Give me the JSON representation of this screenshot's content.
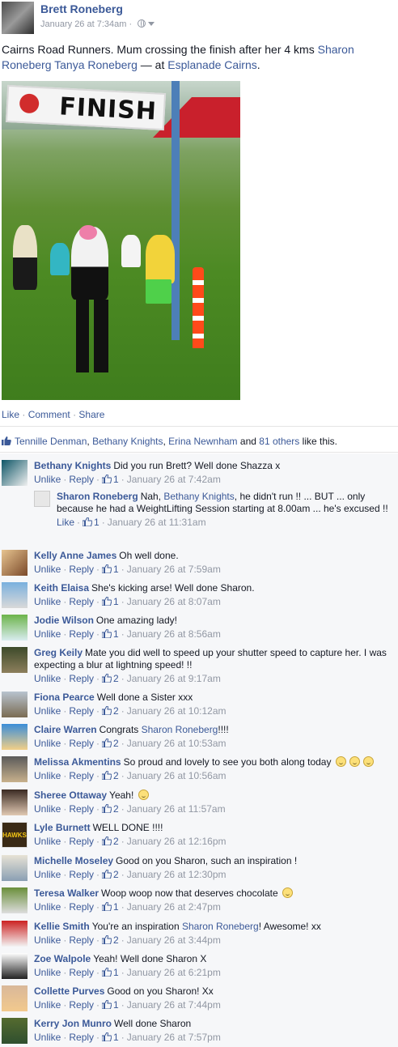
{
  "post": {
    "author": "Brett Roneberg",
    "time": "January 26 at 7:34am",
    "separator": "·",
    "privacy_icon": "globe-icon",
    "text_prefix": "Cairns Road Runners. Mum crossing the finish after her 4 kms ",
    "tag1": "Sharon Roneberg",
    "tag2": "Tanya Roneberg",
    "at_text": " — at ",
    "place": "Esplanade Cairns",
    "period": ".",
    "photo_banner": "FINISH"
  },
  "actions": {
    "like": "Like",
    "comment": "Comment",
    "share": "Share",
    "dot": "·"
  },
  "likes": {
    "icon": "thumbs-up-icon",
    "name1": "Tennille Denman",
    "name2": "Bethany Knights",
    "name3": "Erina Newnham",
    "and": "and",
    "others": "81 others",
    "suffix": "like this.",
    "comma": ","
  },
  "comments": [
    {
      "name": "Bethany Knights",
      "text": "Did you run Brett? Well done Shazza x",
      "action": "Unlike",
      "reply": "Reply",
      "likes": "1",
      "time": "January 26 at 7:42am"
    },
    {
      "name": "Sharon Roneberg",
      "text_a": "Nah, ",
      "mention": "Bethany Knights",
      "text_b": ", he didn't run !! ... BUT ... only because he had a WeightLifting Session starting at 8.00am ... he's excused !!",
      "action": "Like",
      "likes": "1",
      "time": "January 26 at 11:31am"
    },
    {
      "name": "Kelly Anne James",
      "text": "Oh well done.",
      "action": "Unlike",
      "reply": "Reply",
      "likes": "1",
      "time": "January 26 at 7:59am"
    },
    {
      "name": "Keith Elaisa",
      "text": "She's kicking arse! Well done Sharon.",
      "action": "Unlike",
      "reply": "Reply",
      "likes": "1",
      "time": "January 26 at 8:07am"
    },
    {
      "name": "Jodie Wilson",
      "text": "One amazing lady!",
      "action": "Unlike",
      "reply": "Reply",
      "likes": "1",
      "time": "January 26 at 8:56am"
    },
    {
      "name": "Greg Keily",
      "text": "Mate you did well to speed up your shutter speed to capture her. I was expecting a blur at lightning speed! !!",
      "action": "Unlike",
      "reply": "Reply",
      "likes": "2",
      "time": "January 26 at 9:17am"
    },
    {
      "name": "Fiona Pearce",
      "text": "Well done a Sister xxx",
      "action": "Unlike",
      "reply": "Reply",
      "likes": "2",
      "time": "January 26 at 10:12am"
    },
    {
      "name": "Claire Warren",
      "text_a": "Congrats ",
      "mention": "Sharon Roneberg",
      "text_b": "!!!!",
      "action": "Unlike",
      "reply": "Reply",
      "likes": "2",
      "time": "January 26 at 10:53am"
    },
    {
      "name": "Melissa Akmentins",
      "text": "So proud and lovely to see you both along today",
      "action": "Unlike",
      "reply": "Reply",
      "likes": "2",
      "time": "January 26 at 10:56am"
    },
    {
      "name": "Sheree Ottaway",
      "text": "Yeah!",
      "action": "Unlike",
      "reply": "Reply",
      "likes": "2",
      "time": "January 26 at 11:57am"
    },
    {
      "name": "Lyle Burnett",
      "text": "WELL DONE !!!!",
      "action": "Unlike",
      "reply": "Reply",
      "likes": "2",
      "time": "January 26 at 12:16pm",
      "avatar_text": "HAWKS"
    },
    {
      "name": "Michelle Moseley",
      "text": "Good on you Sharon, such an inspiration !",
      "action": "Unlike",
      "reply": "Reply",
      "likes": "2",
      "time": "January 26 at 12:30pm"
    },
    {
      "name": "Teresa Walker",
      "text": "Woop woop now that deserves chocolate",
      "action": "Unlike",
      "reply": "Reply",
      "likes": "1",
      "time": "January 26 at 2:47pm"
    },
    {
      "name": "Kellie Smith",
      "text_a": "You're an inspiration ",
      "mention": "Sharon Roneberg",
      "text_b": "! Awesome! xx",
      "action": "Unlike",
      "reply": "Reply",
      "likes": "2",
      "time": "January 26 at 3:44pm"
    },
    {
      "name": "Zoe Walpole",
      "text": "Yeah! Well done Sharon X",
      "action": "Unlike",
      "reply": "Reply",
      "likes": "1",
      "time": "January 26 at 6:21pm"
    },
    {
      "name": "Collette Purves",
      "text": "Good on you Sharon! Xx",
      "action": "Unlike",
      "reply": "Reply",
      "likes": "1",
      "time": "January 26 at 7:44pm"
    },
    {
      "name": "Kerry Jon Munro",
      "text": "Well done Sharon",
      "action": "Unlike",
      "reply": "Reply",
      "likes": "1",
      "time": "January 26 at 7:57pm"
    }
  ],
  "footer_sep": "·",
  "colors": {
    "link": "#3b5998",
    "meta": "#9197a3",
    "comment_bg": "#f6f7f9"
  }
}
